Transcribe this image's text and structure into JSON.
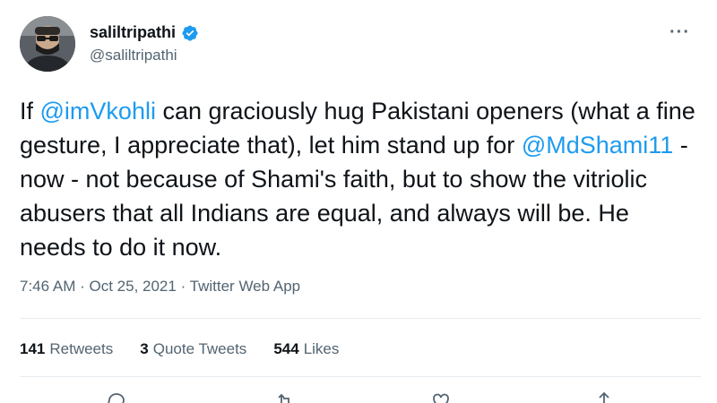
{
  "author": {
    "display_name": "saliltripathi",
    "handle": "@saliltripathi",
    "verified": true
  },
  "tweet": {
    "segments": [
      {
        "text": "If ",
        "type": "text"
      },
      {
        "text": "@imVkohli",
        "type": "mention"
      },
      {
        "text": " can graciously hug Pakistani openers (what a fine gesture, I appreciate that), let him stand up for ",
        "type": "text"
      },
      {
        "text": "@MdShami11",
        "type": "mention"
      },
      {
        "text": " - now - not because of Shami's faith, but to show the vitriolic abusers that all Indians are equal, and always will be. He needs to do it now.",
        "type": "text"
      }
    ]
  },
  "meta": {
    "time": "7:46 AM",
    "date": "Oct 25, 2021",
    "source": "Twitter Web App"
  },
  "stats": {
    "retweets_count": "141",
    "retweets_label": "Retweets",
    "quotes_count": "3",
    "quotes_label": "Quote Tweets",
    "likes_count": "544",
    "likes_label": "Likes"
  },
  "icons": {
    "more": "more-icon",
    "verified": "verified-badge-icon",
    "reply": "reply-icon",
    "retweet": "retweet-icon",
    "like": "like-icon",
    "share": "share-icon"
  },
  "colors": {
    "accent": "#1d9bf0",
    "text": "#0f1419",
    "secondary": "#536471",
    "divider": "#e6ecf0"
  }
}
